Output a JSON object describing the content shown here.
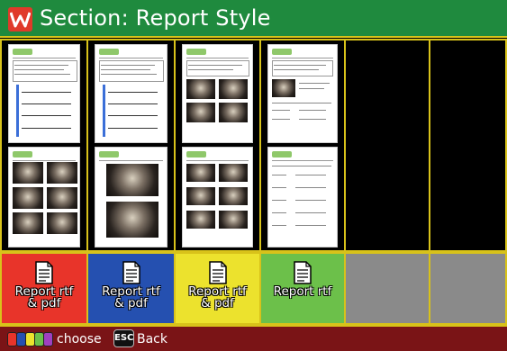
{
  "header": {
    "title": "Section: Report Style",
    "logo_icon": "red-w-logo"
  },
  "thumbnails": {
    "layouts": [
      "sketch-diagram-report",
      "sketch-diagram-report",
      "photo-grid-report",
      "text-table-report",
      "empty",
      "empty"
    ]
  },
  "buttons": [
    {
      "label": "Report rtf\n& pdf",
      "color": "#e8342a",
      "icon": "document-icon"
    },
    {
      "label": "Report rtf\n& pdf",
      "color": "#2550b0",
      "icon": "document-icon"
    },
    {
      "label": "Report rtf\n& pdf",
      "color": "#ece22d",
      "icon": "document-icon"
    },
    {
      "label": "Report rtf",
      "color": "#6cc04a",
      "icon": "document-icon"
    },
    {
      "label": "",
      "color": "#8a8a8a"
    },
    {
      "label": "",
      "color": "#8a8a8a"
    }
  ],
  "footer": {
    "color_keys": [
      "#e8342a",
      "#2550b0",
      "#ece22d",
      "#6cc04a",
      "#a040c0"
    ],
    "choose_label": "choose",
    "esc_key": "ESC",
    "back_label": "Back"
  }
}
